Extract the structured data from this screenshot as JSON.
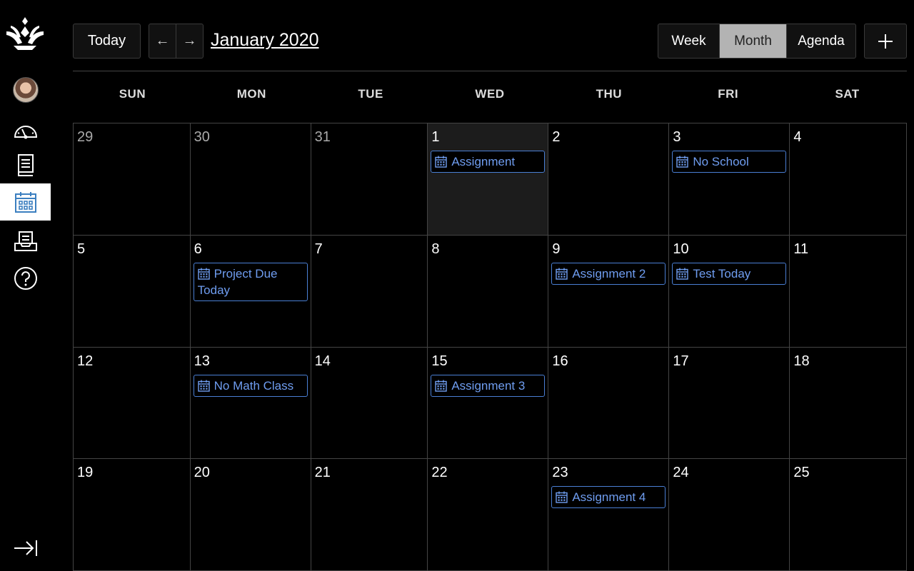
{
  "header": {
    "today_label": "Today",
    "prev_label": "←",
    "next_label": "→",
    "month_title": "January 2020",
    "views": [
      {
        "label": "Week",
        "active": false
      },
      {
        "label": "Month",
        "active": true
      },
      {
        "label": "Agenda",
        "active": false
      }
    ],
    "add_label": "+"
  },
  "sidebar": {
    "items": [
      {
        "name": "logo-icon"
      },
      {
        "name": "avatar"
      },
      {
        "name": "dashboard-icon"
      },
      {
        "name": "courses-icon"
      },
      {
        "name": "calendar-icon",
        "active": true
      },
      {
        "name": "inbox-icon"
      },
      {
        "name": "help-icon"
      },
      {
        "name": "collapse-nav-icon"
      }
    ]
  },
  "weekdays": [
    "SUN",
    "MON",
    "TUE",
    "WED",
    "THU",
    "FRI",
    "SAT"
  ],
  "weeks": [
    [
      {
        "day": "29",
        "other": true
      },
      {
        "day": "30",
        "other": true
      },
      {
        "day": "31",
        "other": true
      },
      {
        "day": "1",
        "today": true,
        "events": [
          "Assignment"
        ]
      },
      {
        "day": "2"
      },
      {
        "day": "3",
        "events": [
          "No School"
        ]
      },
      {
        "day": "4"
      }
    ],
    [
      {
        "day": "5"
      },
      {
        "day": "6",
        "events": [
          "Project Due Today"
        ]
      },
      {
        "day": "7"
      },
      {
        "day": "8"
      },
      {
        "day": "9",
        "events": [
          "Assignment 2"
        ]
      },
      {
        "day": "10",
        "events": [
          "Test Today"
        ]
      },
      {
        "day": "11"
      }
    ],
    [
      {
        "day": "12"
      },
      {
        "day": "13",
        "events": [
          "No Math Class"
        ]
      },
      {
        "day": "14"
      },
      {
        "day": "15",
        "events": [
          "Assignment 3"
        ]
      },
      {
        "day": "16"
      },
      {
        "day": "17"
      },
      {
        "day": "18"
      }
    ],
    [
      {
        "day": "19"
      },
      {
        "day": "20"
      },
      {
        "day": "21"
      },
      {
        "day": "22"
      },
      {
        "day": "23",
        "events": [
          "Assignment 4"
        ]
      },
      {
        "day": "24"
      },
      {
        "day": "25"
      }
    ]
  ],
  "colors": {
    "event_border": "#4a7fd4",
    "event_text": "#6f9df0",
    "active_view_bg": "#b3b3b3",
    "today_cell_bg": "#1c1c1c"
  }
}
